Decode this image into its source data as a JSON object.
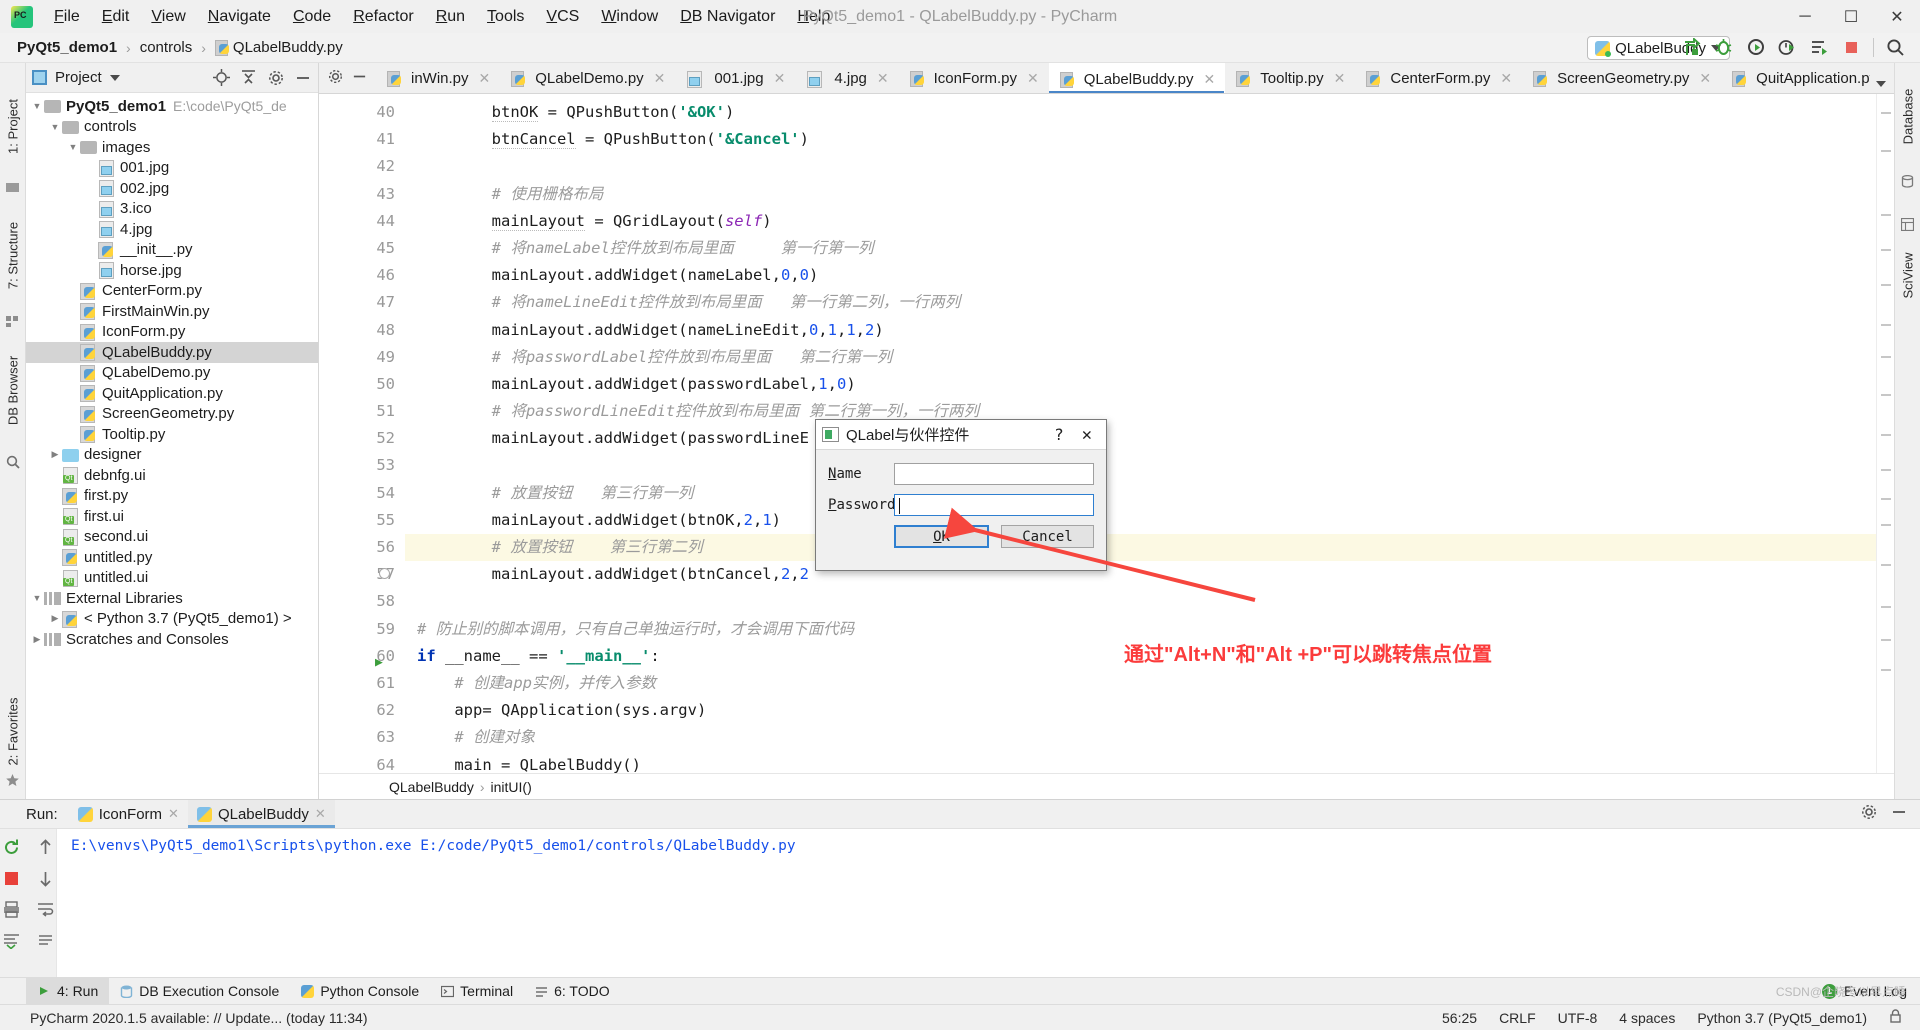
{
  "window": {
    "title": "PyQt5_demo1 - QLabelBuddy.py - PyCharm",
    "minimize": "─",
    "maximize": "☐",
    "close": "✕"
  },
  "menubar": {
    "logo": "pycharm-logo",
    "items": [
      "File",
      "Edit",
      "View",
      "Navigate",
      "Code",
      "Refactor",
      "Run",
      "Tools",
      "VCS",
      "Window",
      "DB Navigator",
      "Help"
    ]
  },
  "breadcrumbs": {
    "project": "PyQt5_demo1",
    "folder": "controls",
    "file": "QLabelBuddy.py",
    "separator": "›"
  },
  "run_config": {
    "name": "QLabelBuddy",
    "icons": [
      "run-icon",
      "debug-icon",
      "coverage-icon",
      "profile-icon",
      "run-with-console-icon",
      "stop-icon",
      "search-everywhere-icon"
    ]
  },
  "left_strip": {
    "items": [
      "1: Project",
      "7: Structure",
      "DB Browser"
    ],
    "bottom_items": [
      "2: Favorites"
    ]
  },
  "right_strip": {
    "items": [
      "Database",
      "SciView"
    ]
  },
  "project_panel": {
    "header": "Project",
    "header_icons": [
      "locate-icon",
      "collapse-all-icon",
      "settings-icon",
      "hide-icon"
    ],
    "tree": [
      {
        "depth": 0,
        "arrow": "▼",
        "icon": "folder",
        "label": "PyQt5_demo1",
        "path": "E:\\code\\PyQt5_de",
        "bold": true,
        "selected": false
      },
      {
        "depth": 1,
        "arrow": "▼",
        "icon": "folder",
        "label": "controls",
        "path": "",
        "bold": false,
        "selected": false
      },
      {
        "depth": 2,
        "arrow": "▼",
        "icon": "folder",
        "label": "images",
        "path": "",
        "bold": false,
        "selected": false
      },
      {
        "depth": 3,
        "arrow": "",
        "icon": "file-img",
        "label": "001.jpg",
        "path": "",
        "bold": false,
        "selected": false
      },
      {
        "depth": 3,
        "arrow": "",
        "icon": "file-img",
        "label": "002.jpg",
        "path": "",
        "bold": false,
        "selected": false
      },
      {
        "depth": 3,
        "arrow": "",
        "icon": "file-img",
        "label": "3.ico",
        "path": "",
        "bold": false,
        "selected": false
      },
      {
        "depth": 3,
        "arrow": "",
        "icon": "file-img",
        "label": "4.jpg",
        "path": "",
        "bold": false,
        "selected": false
      },
      {
        "depth": 3,
        "arrow": "",
        "icon": "file-py",
        "label": "__init__.py",
        "path": "",
        "bold": false,
        "selected": false
      },
      {
        "depth": 3,
        "arrow": "",
        "icon": "file-img",
        "label": "horse.jpg",
        "path": "",
        "bold": false,
        "selected": false
      },
      {
        "depth": 2,
        "arrow": "",
        "icon": "file-py",
        "label": "CenterForm.py",
        "path": "",
        "bold": false,
        "selected": false
      },
      {
        "depth": 2,
        "arrow": "",
        "icon": "file-py",
        "label": "FirstMainWin.py",
        "path": "",
        "bold": false,
        "selected": false
      },
      {
        "depth": 2,
        "arrow": "",
        "icon": "file-py",
        "label": "IconForm.py",
        "path": "",
        "bold": false,
        "selected": false
      },
      {
        "depth": 2,
        "arrow": "",
        "icon": "file-py",
        "label": "QLabelBuddy.py",
        "path": "",
        "bold": false,
        "selected": true
      },
      {
        "depth": 2,
        "arrow": "",
        "icon": "file-py",
        "label": "QLabelDemo.py",
        "path": "",
        "bold": false,
        "selected": false
      },
      {
        "depth": 2,
        "arrow": "",
        "icon": "file-py",
        "label": "QuitApplication.py",
        "path": "",
        "bold": false,
        "selected": false
      },
      {
        "depth": 2,
        "arrow": "",
        "icon": "file-py",
        "label": "ScreenGeometry.py",
        "path": "",
        "bold": false,
        "selected": false
      },
      {
        "depth": 2,
        "arrow": "",
        "icon": "file-py",
        "label": "Tooltip.py",
        "path": "",
        "bold": false,
        "selected": false
      },
      {
        "depth": 1,
        "arrow": "▶",
        "icon": "folder-blue",
        "label": "designer",
        "path": "",
        "bold": false,
        "selected": false
      },
      {
        "depth": 1,
        "arrow": "",
        "icon": "file-ui",
        "label": "debnfg.ui",
        "path": "",
        "bold": false,
        "selected": false
      },
      {
        "depth": 1,
        "arrow": "",
        "icon": "file-py",
        "label": "first.py",
        "path": "",
        "bold": false,
        "selected": false
      },
      {
        "depth": 1,
        "arrow": "",
        "icon": "file-ui",
        "label": "first.ui",
        "path": "",
        "bold": false,
        "selected": false
      },
      {
        "depth": 1,
        "arrow": "",
        "icon": "file-ui",
        "label": "second.ui",
        "path": "",
        "bold": false,
        "selected": false
      },
      {
        "depth": 1,
        "arrow": "",
        "icon": "file-py",
        "label": "untitled.py",
        "path": "",
        "bold": false,
        "selected": false
      },
      {
        "depth": 1,
        "arrow": "",
        "icon": "file-ui",
        "label": "untitled.ui",
        "path": "",
        "bold": false,
        "selected": false
      },
      {
        "depth": 0,
        "arrow": "▼",
        "icon": "library",
        "label": "External Libraries",
        "path": "",
        "bold": false,
        "selected": false
      },
      {
        "depth": 1,
        "arrow": "▶",
        "icon": "file-py",
        "label": "< Python 3.7 (PyQt5_demo1) >",
        "path": "",
        "bold": false,
        "selected": false
      },
      {
        "depth": 0,
        "arrow": "▶",
        "icon": "library",
        "label": "Scratches and Consoles",
        "path": "",
        "bold": false,
        "selected": false
      }
    ]
  },
  "editor_tabs": [
    {
      "label": "inWin.py",
      "icon": "file-py",
      "active": false
    },
    {
      "label": "QLabelDemo.py",
      "icon": "file-py",
      "active": false
    },
    {
      "label": "001.jpg",
      "icon": "file-img",
      "active": false
    },
    {
      "label": "4.jpg",
      "icon": "file-img",
      "active": false
    },
    {
      "label": "IconForm.py",
      "icon": "file-py",
      "active": false
    },
    {
      "label": "QLabelBuddy.py",
      "icon": "file-py",
      "active": true
    },
    {
      "label": "Tooltip.py",
      "icon": "file-py",
      "active": false
    },
    {
      "label": "CenterForm.py",
      "icon": "file-py",
      "active": false
    },
    {
      "label": "ScreenGeometry.py",
      "icon": "file-py",
      "active": false
    },
    {
      "label": "QuitApplication.py",
      "icon": "file-py",
      "active": false
    }
  ],
  "editor": {
    "first_line_number": 40,
    "lines": [
      {
        "n": 40,
        "html": "        <span class='und'>btnOK</span> = QPushButton(<span class='str'>'&amp;OK'</span>)",
        "hl": false,
        "mark": "",
        "fold": false
      },
      {
        "n": 41,
        "html": "        <span class='und'>btnCancel</span> = QPushButton(<span class='str'>'&amp;Cancel'</span>)",
        "hl": false,
        "mark": "",
        "fold": false
      },
      {
        "n": 42,
        "html": "",
        "hl": false,
        "mark": "",
        "fold": false
      },
      {
        "n": 43,
        "html": "        <span class='cmt'># 使用栅格布局</span>",
        "hl": false,
        "mark": "",
        "fold": false
      },
      {
        "n": 44,
        "html": "        <span class='und'>mainLayout</span> = QGridLayout(<span class='self'>self</span>)",
        "hl": false,
        "mark": "",
        "fold": false
      },
      {
        "n": 45,
        "html": "        <span class='cmt'># 将nameLabel控件放到布局里面     第一行第一列</span>",
        "hl": false,
        "mark": "",
        "fold": false
      },
      {
        "n": 46,
        "html": "        mainLayout.addWidget(nameLabel,<span class='num'>0</span>,<span class='num'>0</span>)",
        "hl": false,
        "mark": "",
        "fold": false
      },
      {
        "n": 47,
        "html": "        <span class='cmt'># 将nameLineEdit控件放到布局里面   第一行第二列，一行两列</span>",
        "hl": false,
        "mark": "",
        "fold": false
      },
      {
        "n": 48,
        "html": "        mainLayout.addWidget(nameLineEdit,<span class='num'>0</span>,<span class='num'>1</span>,<span class='num'>1</span>,<span class='num'>2</span>)",
        "hl": false,
        "mark": "",
        "fold": false
      },
      {
        "n": 49,
        "html": "        <span class='cmt'># 将passwordLabel控件放到布局里面   第二行第一列</span>",
        "hl": false,
        "mark": "",
        "fold": false
      },
      {
        "n": 50,
        "html": "        mainLayout.addWidget(passwordLabel,<span class='num'>1</span>,<span class='num'>0</span>)",
        "hl": false,
        "mark": "",
        "fold": false
      },
      {
        "n": 51,
        "html": "        <span class='cmt'># 将passwordLineEdit控件放到布局里面 第二行第一列，一行两列</span>",
        "hl": false,
        "mark": "",
        "fold": false
      },
      {
        "n": 52,
        "html": "        mainLayout.addWidget(passwordLineE",
        "hl": false,
        "mark": "",
        "fold": false
      },
      {
        "n": 53,
        "html": "",
        "hl": false,
        "mark": "",
        "fold": false
      },
      {
        "n": 54,
        "html": "        <span class='cmt'># 放置按钮   第三行第一列</span>",
        "hl": false,
        "mark": "",
        "fold": false
      },
      {
        "n": 55,
        "html": "        mainLayout.addWidget(btnOK,<span class='num'>2</span>,<span class='num'>1</span>)",
        "hl": false,
        "mark": "",
        "fold": false
      },
      {
        "n": 56,
        "html": "        <span class='cmt'># 放置按钮    第三行第二列</span>",
        "hl": true,
        "mark": "",
        "fold": false
      },
      {
        "n": 57,
        "html": "        mainLayout.addWidget(btnCancel,<span class='num'>2</span>,<span class='num'>2</span>",
        "hl": false,
        "mark": "",
        "fold": true
      },
      {
        "n": 58,
        "html": "",
        "hl": false,
        "mark": "",
        "fold": false
      },
      {
        "n": 59,
        "html": "<span class='cmt'># 防止别的脚本调用，只有自己单独运行时，才会调用下面代码</span>",
        "hl": false,
        "mark": "",
        "fold": false
      },
      {
        "n": 60,
        "html": "<span class='kw'>if</span> __name__ == <span class='str'>'__main__'</span>:",
        "hl": false,
        "mark": "▶",
        "fold": false
      },
      {
        "n": 61,
        "html": "    <span class='cmt'># 创建app实例，并传入参数</span>",
        "hl": false,
        "mark": "",
        "fold": false
      },
      {
        "n": 62,
        "html": "    app= QApplication(sys.argv)",
        "hl": false,
        "mark": "",
        "fold": false
      },
      {
        "n": 63,
        "html": "    <span class='cmt'># 创建对象</span>",
        "hl": false,
        "mark": "",
        "fold": false
      },
      {
        "n": 64,
        "html": "    main = QLabelBuddy()",
        "hl": false,
        "mark": "",
        "fold": false
      }
    ],
    "footer_crumbs": [
      "QLabelBuddy",
      "initUI()"
    ],
    "footer_sep": "›"
  },
  "dialog": {
    "title": "QLabel与伙伴控件",
    "help_btn": "?",
    "close_btn": "✕",
    "name_label": "Name",
    "name_label_mnemonic": "N",
    "name_value": "",
    "password_label": "Password",
    "password_label_mnemonic": "P",
    "password_value": "",
    "ok_label": "OK",
    "ok_mnemonic": "O",
    "cancel_label": "Cancel",
    "cancel_mnemonic": "C"
  },
  "annotation": {
    "text": "通过\"Alt+N\"和\"Alt +P\"可以跳转焦点位置",
    "color": "#fb3b3b"
  },
  "run_panel": {
    "label": "Run:",
    "tabs": [
      {
        "label": "IconForm",
        "active": false
      },
      {
        "label": "QLabelBuddy",
        "active": true
      }
    ],
    "side_icons": [
      "rerun-icon",
      "up-icon",
      "stop-icon",
      "down-icon",
      "print-icon",
      "soft-wrap-icon",
      "scroll-to-end-icon",
      "clear-all-icon"
    ],
    "header_icons": [
      "settings-icon",
      "hide-icon"
    ],
    "output": "E:\\venvs\\PyQt5_demo1\\Scripts\\python.exe E:/code/PyQt5_demo1/controls/QLabelBuddy.py"
  },
  "tool_strip": {
    "items": [
      {
        "label": "4: Run",
        "icon": "run-icon",
        "active": true
      },
      {
        "label": "DB Execution Console",
        "icon": "db-icon",
        "active": false
      },
      {
        "label": "Python Console",
        "icon": "python-icon",
        "active": false
      },
      {
        "label": "Terminal",
        "icon": "terminal-icon",
        "active": false
      },
      {
        "label": "6: TODO",
        "icon": "todo-icon",
        "active": false
      }
    ],
    "event_log": "Event Log",
    "event_count": "1"
  },
  "status_bar": {
    "message": "PyCharm 2020.1.5 available: // Update... (today 11:34)",
    "caret": "56:25",
    "line_sep": "CRLF",
    "encoding": "UTF-8",
    "indent": "4 spaces",
    "interpreter": "Python 3.7 (PyQt5_demo1)",
    "lock": "lock-icon"
  },
  "watermark": "CSDN@企晓冬以早点睡"
}
